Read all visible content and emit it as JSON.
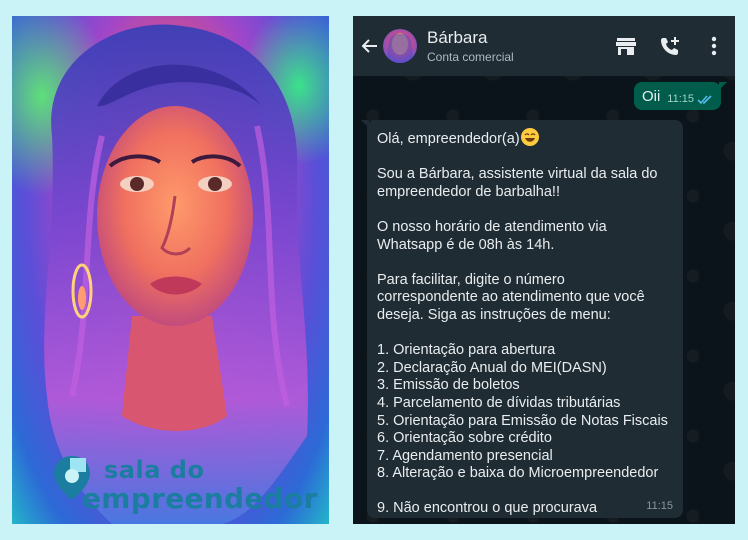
{
  "brand": {
    "line1": "sala do",
    "line2": "empreendedor"
  },
  "chat": {
    "contact_name": "Bárbara",
    "contact_status": "Conta comercial",
    "icons": [
      "back-arrow-icon",
      "store-icon",
      "add-call-icon",
      "more-vert-icon"
    ],
    "sent": {
      "text": "Oii",
      "time": "11:15",
      "status": "read"
    },
    "received": {
      "time": "11:15",
      "greeting": "Olá, empreendedor(a)",
      "lines": [
        "",
        "Sou a Bárbara, assistente virtual da sala do",
        "empreendedor de barbalha!!",
        "",
        "O nosso horário de atendimento via",
        "Whatsapp é de 08h às 14h.",
        "",
        "Para facilitar, digite o número",
        "correspondente ao atendimento que você",
        "deseja. Siga as instruções de menu:",
        "",
        "1. Orientação para abertura",
        "2. Declaração Anual do MEI(DASN)",
        "3. Emissão de boletos",
        "4. Parcelamento de dívidas tributárias",
        "5. Orientação para Emissão de Notas Fiscais",
        "6. Orientação sobre crédito",
        "7. Agendamento presencial",
        "8. Alteração e baixa do Microempreendedor",
        "",
        "9. Não encontrou o que procurava"
      ]
    }
  },
  "colors": {
    "page_bg": "#c9f3f7",
    "header_bg": "#1f2c34",
    "sent_bubble": "#005c4b",
    "received_bubble": "#1f2c34",
    "chat_bg": "#0b141a",
    "read_ticks": "#53bdeb",
    "brand_text": "#1b7ea0"
  }
}
